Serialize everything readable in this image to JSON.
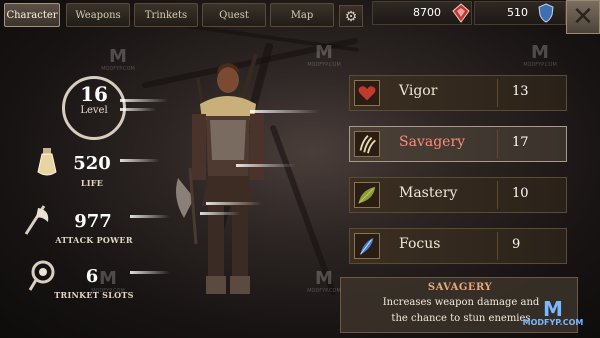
{
  "tabs": [
    {
      "label": "Character",
      "active": true
    },
    {
      "label": "Weapons",
      "active": false
    },
    {
      "label": "Trinkets",
      "active": false
    },
    {
      "label": "Quest",
      "active": false
    },
    {
      "label": "Map",
      "active": false
    }
  ],
  "settings_icon": "gear-icon",
  "currency": {
    "gold": "8700",
    "gold_icon": "red-gem-icon",
    "gems": "510",
    "gems_icon": "blue-shield-gem-icon"
  },
  "close_icon": "close-x-icon",
  "stats": {
    "level_value": "16",
    "level_label": "Level",
    "life_value": "520",
    "life_label": "LIFE",
    "attack_value": "977",
    "attack_label": "ATTACK POWER",
    "slots_value": "6",
    "slots_label": "TRINKET SLOTS"
  },
  "attributes": [
    {
      "name": "Vigor",
      "value": "13",
      "icon": "heart-rune-icon"
    },
    {
      "name": "Savagery",
      "value": "17",
      "icon": "claw-icon",
      "selected": true
    },
    {
      "name": "Mastery",
      "value": "10",
      "icon": "leaf-blade-icon"
    },
    {
      "name": "Focus",
      "value": "9",
      "icon": "blue-feather-icon"
    }
  ],
  "info": {
    "title": "SAVAGERY",
    "line1": "Increases weapon damage and",
    "line2": "the chance to stun enemies"
  },
  "watermark": {
    "letter": "M",
    "text": "MODFYP.COM",
    "corner_text": "MODFYP.COM"
  },
  "colors": {
    "selected_attr": "#ff8a7a",
    "info_title": "#e8a87a",
    "gold_gem": "#d83a3a",
    "blue_gem": "#3f6fb0"
  }
}
